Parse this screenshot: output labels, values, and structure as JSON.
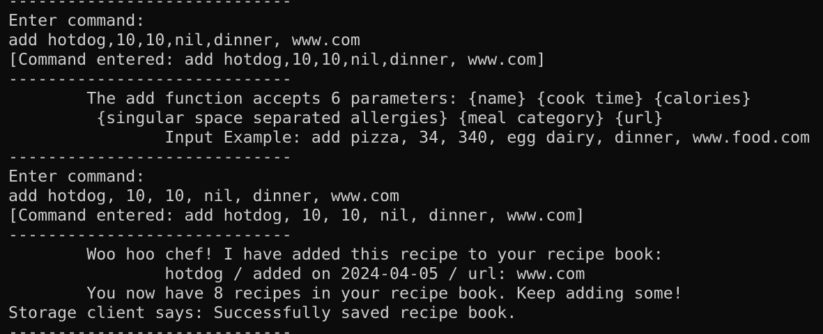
{
  "terminal": {
    "lines": [
      "-----------------------------",
      "Enter command:",
      "add hotdog,10,10,nil,dinner, www.com",
      "[Command entered: add hotdog,10,10,nil,dinner, www.com]",
      "-----------------------------",
      "        The add function accepts 6 parameters: {name} {cook time} {calories}",
      "         {singular space separated allergies} {meal category} {url}",
      "                Input Example: add pizza, 34, 340, egg dairy, dinner, www.food.com",
      "-----------------------------",
      "Enter command:",
      "add hotdog, 10, 10, nil, dinner, www.com",
      "[Command entered: add hotdog, 10, 10, nil, dinner, www.com]",
      "-----------------------------",
      "        Woo hoo chef! I have added this recipe to your recipe book:",
      "                hotdog / added on 2024-04-05 / url: www.com",
      "        You now have 8 recipes in your recipe book. Keep adding some!",
      "Storage client says: Successfully saved recipe book.",
      "-----------------------------"
    ],
    "colors": {
      "background": "#0c0c0c",
      "text": "#cccccc"
    }
  }
}
